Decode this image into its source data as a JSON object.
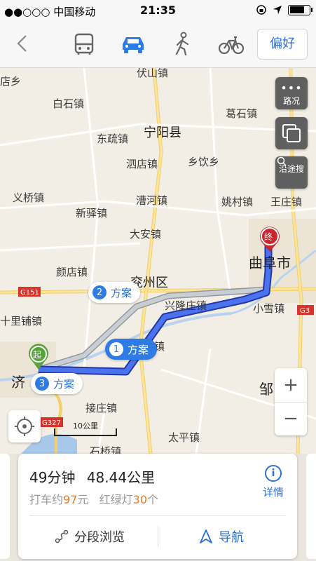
{
  "status_bar": {
    "carrier": "●●○○○ 中国移动",
    "time": "21:35"
  },
  "header": {
    "preference_label": "偏好"
  },
  "map": {
    "places": [
      {
        "name": "伏山镇"
      },
      {
        "name": "店乡"
      },
      {
        "name": "白石镇"
      },
      {
        "name": "葛石镇"
      },
      {
        "name": "宁阳县"
      },
      {
        "name": "东疏镇"
      },
      {
        "name": "泗店镇"
      },
      {
        "name": "乡饮乡"
      },
      {
        "name": "义桥镇"
      },
      {
        "name": "漕河镇"
      },
      {
        "name": "姚村镇"
      },
      {
        "name": "王庄镇"
      },
      {
        "name": "新驿镇"
      },
      {
        "name": "大安镇"
      },
      {
        "name": "曲阜市"
      },
      {
        "name": "颜店镇"
      },
      {
        "name": "兖州区"
      },
      {
        "name": "兴隆庄镇"
      },
      {
        "name": "小雪镇"
      },
      {
        "name": "十里铺镇"
      },
      {
        "name": "济"
      },
      {
        "name": "邹"
      },
      {
        "name": "接庄镇"
      },
      {
        "name": "太平镇"
      },
      {
        "name": "石桥镇"
      },
      {
        "name": "镇"
      }
    ],
    "road_shields": [
      "G151",
      "G3",
      "G327"
    ],
    "traffic_label": "路况",
    "search_along_label": "沿途搜",
    "zoom_in": "+",
    "zoom_out": "−",
    "scale_label": "10公里",
    "start_label": "起",
    "end_label": "终",
    "routes": [
      {
        "num": "1",
        "label": "方案"
      },
      {
        "num": "2",
        "label": "方案"
      },
      {
        "num": "3",
        "label": "方案"
      }
    ]
  },
  "summary": {
    "duration": "49分钟",
    "distance": "48.44公里",
    "taxi_prefix": "打车约",
    "taxi_price": "97",
    "taxi_suffix": "元",
    "lights_prefix": "红绿灯",
    "lights_count": "30",
    "lights_suffix": "个",
    "detail_label": "详情",
    "detail_icon": "i",
    "segment_label": "分段浏览",
    "navigate_label": "导航"
  },
  "colors": {
    "accent": "#2f7be6",
    "highlight": "#f0781e",
    "end_pin": "#c8282d",
    "start_pin": "#57a53a"
  }
}
